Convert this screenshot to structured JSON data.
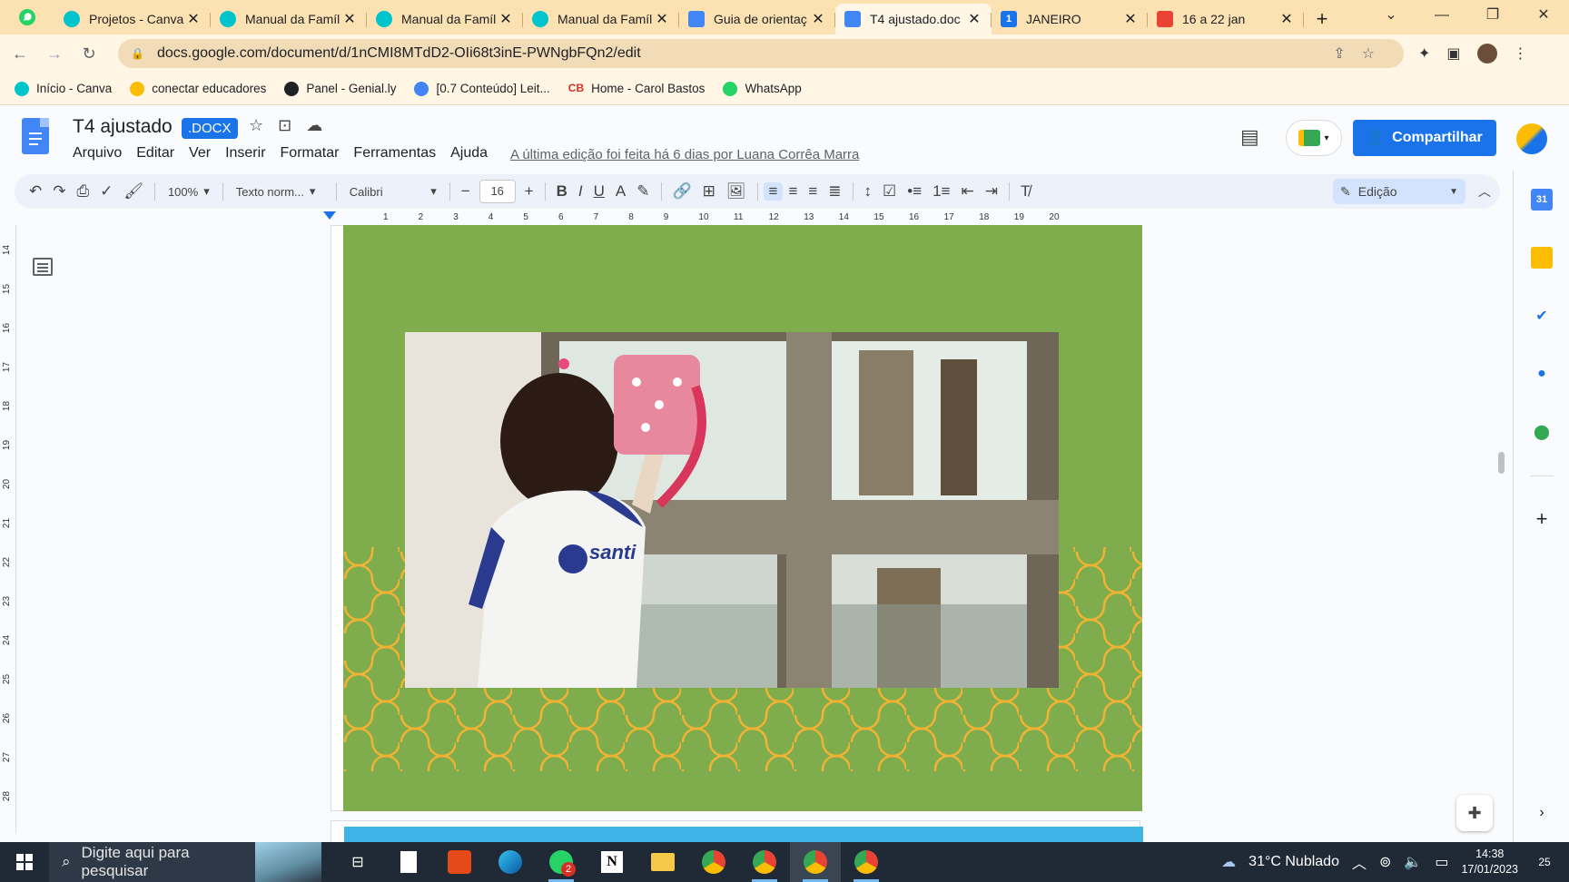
{
  "browser": {
    "tabs": [
      {
        "title": "Projetos - Canva",
        "icon": "canva-icon",
        "color": "#00c4cc"
      },
      {
        "title": "Manual da Famíl",
        "icon": "canva-icon",
        "color": "#00c4cc"
      },
      {
        "title": "Manual da Famíl",
        "icon": "canva-icon",
        "color": "#00c4cc"
      },
      {
        "title": "Manual da Famíl",
        "icon": "canva-icon",
        "color": "#00c4cc"
      },
      {
        "title": "Guia de orientaç",
        "icon": "docs-icon",
        "color": "#4285f4"
      },
      {
        "title": "T4 ajustado.doc",
        "icon": "docs-icon",
        "color": "#4285f4",
        "active": true
      },
      {
        "title": "JANEIRO",
        "icon": "one-icon",
        "color": "#1a73e8",
        "badge": "1"
      },
      {
        "title": "16 a 22 jan",
        "icon": "calendar-icon",
        "color": "#ea4335"
      }
    ],
    "url": "docs.google.com/document/d/1nCMI8MTdD2-OIi68t3inE-PWNgbFQn2/edit",
    "bookmarks": [
      {
        "label": "Início - Canva",
        "color": "#00c4cc"
      },
      {
        "label": "conectar educadores",
        "color": "#fbbc04"
      },
      {
        "label": "Panel - Genial.ly",
        "color": "#202124"
      },
      {
        "label": "[0.7 Conteúdo] Leit...",
        "color": "#4285f4"
      },
      {
        "label": "Home - Carol Bastos",
        "color": "#d93025",
        "mark": "CB"
      },
      {
        "label": "WhatsApp",
        "color": "#25d366"
      }
    ]
  },
  "doc": {
    "title": "T4 ajustado",
    "badge": ".DOCX",
    "menu": [
      "Arquivo",
      "Editar",
      "Ver",
      "Inserir",
      "Formatar",
      "Ferramentas",
      "Ajuda"
    ],
    "last_edit": "A última edição foi feita há 6 dias por Luana Corrêa Marra",
    "share_label": "Compartilhar"
  },
  "toolbar": {
    "zoom": "100%",
    "style": "Texto norm...",
    "font": "Calibri",
    "font_size": "16",
    "mode": "Edição"
  },
  "ruler": {
    "h_ticks": [
      "1",
      "2",
      "3",
      "4",
      "5",
      "6",
      "7",
      "8",
      "9",
      "10",
      "11",
      "12",
      "13",
      "14",
      "15",
      "16",
      "17",
      "18",
      "19",
      "20"
    ],
    "v_ticks": [
      "14",
      "15",
      "16",
      "17",
      "18",
      "19",
      "20",
      "21",
      "22",
      "23",
      "24",
      "25",
      "26",
      "27",
      "28"
    ]
  },
  "photo": {
    "shirt_text": "santi"
  },
  "colors": {
    "page_bg": "#7fac4d",
    "pattern": "#f2b233",
    "next_page_band": "#3cb4e6",
    "accent": "#1a73e8"
  },
  "taskbar": {
    "search_placeholder": "Digite aqui para pesquisar",
    "weather": "31°C  Nublado",
    "time": "14:38",
    "date": "17/01/2023",
    "whatsapp_badge": "2",
    "notifications": "25"
  }
}
